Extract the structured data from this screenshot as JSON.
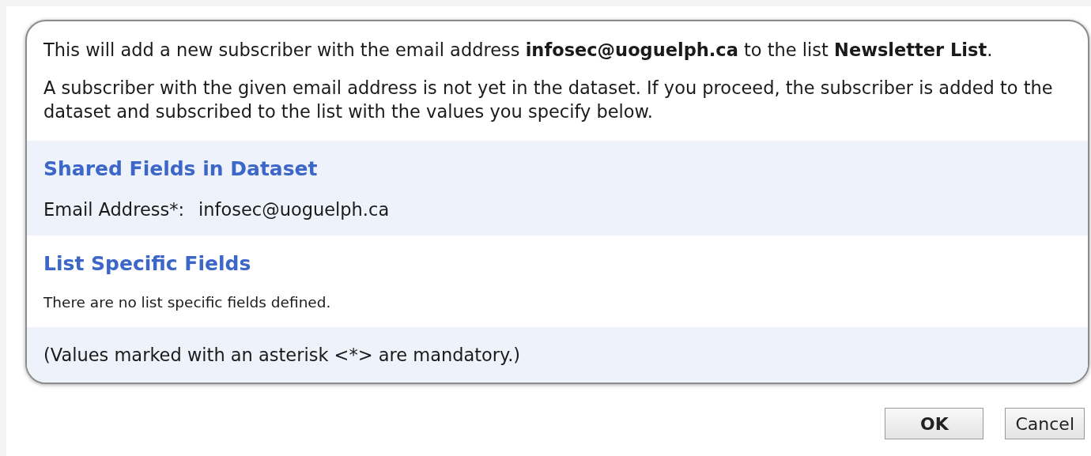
{
  "intro": [
    "This will add a new subscriber with the email address **infosec@uoguelph.ca** to the list **Newsletter List**.",
    "A subscriber with the given email address is not yet in the dataset. If you proceed, the subscriber is added to the dataset and subscribed to the list with the values you specify below."
  ],
  "sections": [
    {
      "title": "Shared Fields in Dataset",
      "kind": "fields",
      "shaded": true,
      "fields": [
        {
          "label": "Email Address*:",
          "value": "infosec@uoguelph.ca"
        }
      ]
    },
    {
      "title": "List Specific Fields",
      "kind": "note",
      "shaded": false,
      "note": "There are no list specific fields defined."
    }
  ],
  "footer_note": "(Values marked with an asterisk <*> are mandatory.)",
  "buttons": [
    {
      "label": "OK",
      "kind": "primary"
    },
    {
      "label": "Cancel",
      "kind": "secondary"
    }
  ]
}
